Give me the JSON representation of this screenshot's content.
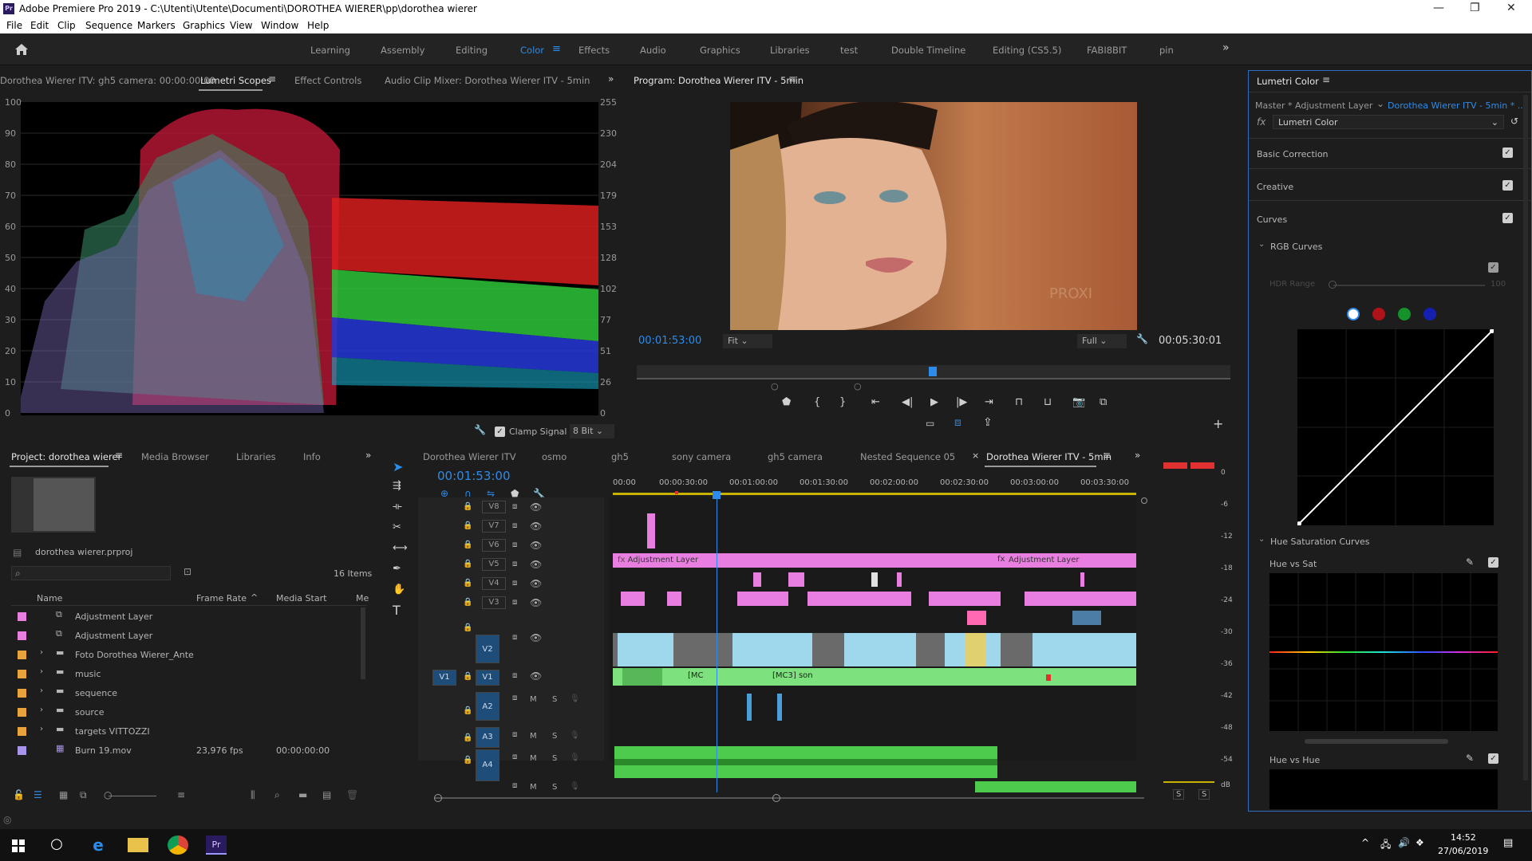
{
  "titlebar": {
    "title": "Adobe Premiere Pro 2019 - C:\\Utenti\\Utente\\Documenti\\DOROTHEA WIERER\\pp\\dorothea wierer",
    "logo": "Pr"
  },
  "menu": [
    "File",
    "Edit",
    "Clip",
    "Sequence",
    "Markers",
    "Graphics",
    "View",
    "Window",
    "Help"
  ],
  "workspaces": [
    "Learning",
    "Assembly",
    "Editing",
    "Color",
    "Effects",
    "Audio",
    "Graphics",
    "Libraries",
    "test",
    "Double Timeline",
    "Editing (CS5.5)",
    "FABI8BIT",
    "pin"
  ],
  "active_workspace": "Color",
  "scopes_panel": {
    "tabs": [
      "Dorothea Wierer ITV: gh5 camera: 00:00:00:00",
      "Lumetri Scopes",
      "Effect Controls",
      "Audio Clip Mixer: Dorothea Wierer ITV - 5min"
    ],
    "active_tab": "Lumetri Scopes",
    "left_scale": [
      "100",
      "90",
      "80",
      "70",
      "60",
      "50",
      "40",
      "30",
      "20",
      "10",
      "0"
    ],
    "right_scale": [
      "255",
      "230",
      "204",
      "179",
      "153",
      "128",
      "102",
      "77",
      "51",
      "26",
      "0"
    ],
    "clamp_label": "Clamp Signal",
    "bit_depth": "8 Bit"
  },
  "program_monitor": {
    "title": "Program: Dorothea Wierer ITV - 5min",
    "timecode": "00:01:53:00",
    "fit": "Fit",
    "quality": "Full",
    "duration": "00:05:30:01",
    "watermark": "PROXI"
  },
  "lumetri": {
    "title": "Lumetri Color",
    "master": "Master * Adjustment Layer",
    "sequence": "Dorothea Wierer ITV - 5min * ...",
    "fx_label": "fx",
    "effect": "Lumetri Color",
    "sections": [
      "Basic Correction",
      "Creative",
      "Curves"
    ],
    "rgb_curves": "RGB Curves",
    "hdr_range": "HDR Range",
    "hdr_value": "100",
    "hue_sat_curves": "Hue Saturation Curves",
    "hue_vs_sat": "Hue vs Sat",
    "hue_vs_hue": "Hue vs Hue"
  },
  "project": {
    "tabs": [
      "Project: dorothea wierer",
      "Media Browser",
      "Libraries",
      "Info"
    ],
    "file": "dorothea wierer.prproj",
    "items_count": "16 Items",
    "columns": [
      "Name",
      "Frame Rate",
      "Media Start",
      "Me"
    ],
    "rows": [
      {
        "name": "Adjustment Layer",
        "color": "#e87fe0",
        "kind": "file",
        "fps": "",
        "start": ""
      },
      {
        "name": "Adjustment Layer",
        "color": "#e87fe0",
        "kind": "file",
        "fps": "",
        "start": ""
      },
      {
        "name": "Foto Dorothea Wierer_Ante",
        "color": "#e8a33a",
        "kind": "folder",
        "fps": "",
        "start": ""
      },
      {
        "name": "music",
        "color": "#e8a33a",
        "kind": "folder",
        "fps": "",
        "start": ""
      },
      {
        "name": "sequence",
        "color": "#e8a33a",
        "kind": "folder",
        "fps": "",
        "start": ""
      },
      {
        "name": "source",
        "color": "#e8a33a",
        "kind": "folder",
        "fps": "",
        "start": ""
      },
      {
        "name": "targets VITTOZZI",
        "color": "#e8a33a",
        "kind": "folder",
        "fps": "",
        "start": ""
      },
      {
        "name": "Burn 19.mov",
        "color": "#a894e8",
        "kind": "clip",
        "fps": "23,976 fps",
        "start": "00:00:00:00"
      }
    ]
  },
  "timeline": {
    "tabs": [
      "Dorothea Wierer ITV",
      "osmo",
      "gh5",
      "sony camera",
      "gh5 camera",
      "Nested Sequence 05",
      "Dorothea Wierer ITV - 5min"
    ],
    "active_tab": "Dorothea Wierer ITV - 5min",
    "timecode": "00:01:53:00",
    "ruler": [
      "00:00",
      "00:00:30:00",
      "00:01:00:00",
      "00:01:30:00",
      "00:02:00:00",
      "00:02:30:00",
      "00:03:00:00",
      "00:03:30:00"
    ],
    "video_tracks": [
      "V8",
      "V7",
      "V6",
      "V5",
      "V4",
      "V3",
      "V2",
      "V1"
    ],
    "audio_tracks": [
      "A2",
      "A3",
      "A4",
      ""
    ],
    "source_patch": "V1",
    "adj_layer_label": "Adjustment Layer",
    "clip_labels": [
      "[MC",
      "[MC3] son"
    ],
    "mute": "M",
    "solo": "S"
  },
  "meters": {
    "scale": [
      "0",
      "-6",
      "-12",
      "-18",
      "-24",
      "-30",
      "-36",
      "-42",
      "-48",
      "-54",
      "dB"
    ],
    "solo_buttons": [
      "S",
      "S"
    ]
  },
  "taskbar": {
    "time": "14:52",
    "date": "27/06/2019"
  }
}
